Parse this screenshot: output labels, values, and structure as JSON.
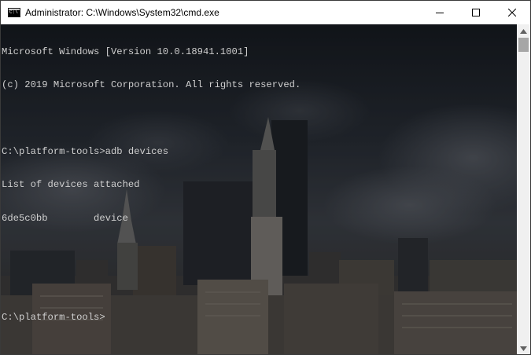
{
  "window": {
    "title": "Administrator: C:\\Windows\\System32\\cmd.exe",
    "icon": "cmd-icon"
  },
  "controls": {
    "minimize_icon": "minimize-icon",
    "maximize_icon": "maximize-icon",
    "close_icon": "close-icon"
  },
  "console": {
    "lines": [
      "Microsoft Windows [Version 10.0.18941.1001]",
      "(c) 2019 Microsoft Corporation. All rights reserved.",
      "",
      "C:\\platform-tools>adb devices",
      "List of devices attached",
      "6de5c0bb        device",
      "",
      "",
      "C:\\platform-tools>"
    ],
    "text_color": "#cfcfcf",
    "background": "city skyline photo"
  },
  "scrollbar": {
    "position": 0
  }
}
